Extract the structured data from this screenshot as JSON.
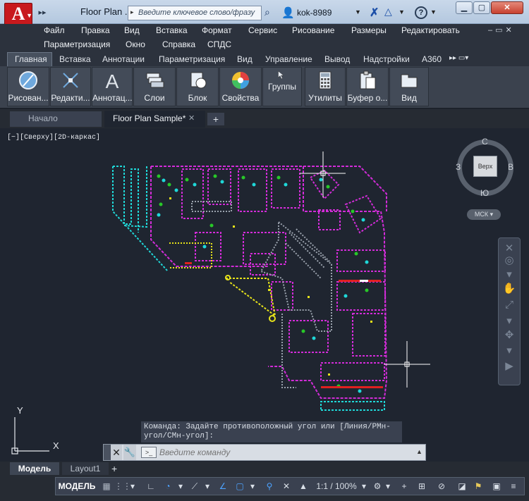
{
  "titlebar": {
    "doc_title": "Floor Plan ...",
    "search_placeholder": "Введите ключевое слово/фразу",
    "user_name": "kok-8989"
  },
  "menu": {
    "row1": [
      "Файл",
      "Правка",
      "Вид",
      "Вставка",
      "Формат",
      "Сервис",
      "Рисование",
      "Размеры",
      "Редактировать"
    ],
    "row2": [
      "Параметризация",
      "Окно",
      "Справка",
      "СПДС"
    ]
  },
  "ribbon_tabs": [
    "Главная",
    "Вставка",
    "Аннотации",
    "Параметризация",
    "Вид",
    "Управление",
    "Вывод",
    "Надстройки",
    "A360"
  ],
  "ribbon_buttons": [
    "Рисован...",
    "Редакти...",
    "Аннотац...",
    "Слои",
    "Блок",
    "Свойства",
    "Группы",
    "Утилиты",
    "Буфер о...",
    "Вид"
  ],
  "file_tabs": {
    "start": "Начало",
    "doc": "Floor Plan Sample*"
  },
  "viewport": {
    "label": "[−][Сверху][2D-каркас]",
    "viewcube": {
      "face": "Верх",
      "north": "С",
      "south": "Ю",
      "west": "З",
      "east": "В"
    },
    "ucs_label": "МСК",
    "axis_x": "X",
    "axis_y": "Y"
  },
  "command": {
    "history": "Команда: Задайте противоположный угол или [Линия/РМн-угол/СМн-угол]:",
    "placeholder": "Введите команду"
  },
  "layout_tabs": {
    "model": "Модель",
    "layout1": "Layout1"
  },
  "status": {
    "model": "МОДЕЛЬ",
    "scale": "1:1 / 100%"
  },
  "colors": {
    "magenta": "#d22cd8",
    "cyan": "#1fd8d8",
    "yellow": "#e6e21a",
    "green": "#28c828",
    "red": "#e02020",
    "gray": "#9aa2ad",
    "white": "#ffffff"
  }
}
